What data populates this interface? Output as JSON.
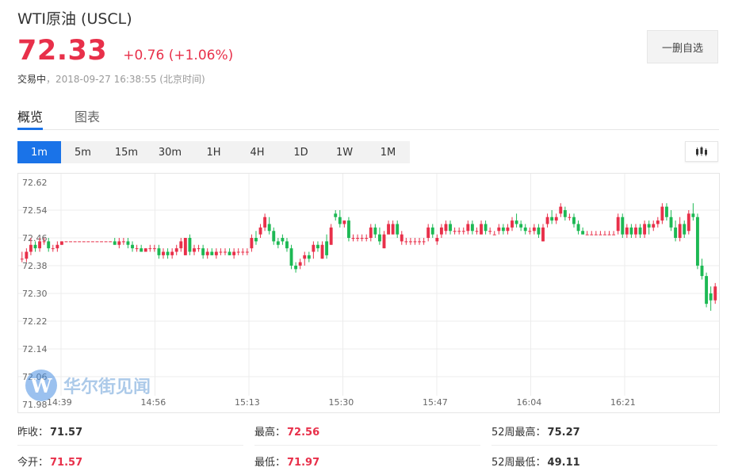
{
  "header": {
    "title": "WTI原油 (USCL)",
    "price": "72.33",
    "change": "+0.76 (+1.06%)",
    "status_label": "交易中",
    "timestamp": "，2018-09-27 16:38:55 (北京时间)",
    "watch_button": "一删自选"
  },
  "tabs": [
    {
      "label": "概览",
      "active": true
    },
    {
      "label": "图表",
      "active": false
    }
  ],
  "periods": [
    {
      "label": "1m",
      "active": true
    },
    {
      "label": "5m"
    },
    {
      "label": "15m"
    },
    {
      "label": "30m"
    },
    {
      "label": "1H"
    },
    {
      "label": "4H"
    },
    {
      "label": "1D"
    },
    {
      "label": "1W"
    },
    {
      "label": "1M"
    }
  ],
  "chart_type_icon": "candlestick-icon",
  "watermark": {
    "logo_letter": "W",
    "text": "华尔街见闻"
  },
  "colors": {
    "up": "#e8304a",
    "down": "#1db954",
    "accent": "#1a73e8"
  },
  "chart_data": {
    "type": "candlestick",
    "y_ticks": [
      "72.62",
      "72.54",
      "72.46",
      "72.38",
      "72.30",
      "72.22",
      "72.14",
      "72.06",
      "71.98"
    ],
    "ylim": [
      71.98,
      72.62
    ],
    "x_ticks": [
      "14:39",
      "14:56",
      "15:13",
      "15:30",
      "15:47",
      "16:04",
      "16:21"
    ],
    "grid": true,
    "candles": [
      [
        72.4,
        72.42,
        72.39,
        72.4
      ],
      [
        72.4,
        72.43,
        72.39,
        72.42
      ],
      [
        72.42,
        72.46,
        72.41,
        72.44
      ],
      [
        72.44,
        72.45,
        72.42,
        72.43
      ],
      [
        72.43,
        72.46,
        72.42,
        72.45
      ],
      [
        72.45,
        72.46,
        72.44,
        72.45
      ],
      [
        72.45,
        72.46,
        72.42,
        72.43
      ],
      [
        72.43,
        72.44,
        72.42,
        72.43
      ],
      [
        72.43,
        72.45,
        72.42,
        72.44
      ],
      [
        72.44,
        72.45,
        72.44,
        72.45
      ],
      [
        72.45,
        72.45,
        72.45,
        72.45
      ],
      [
        72.45,
        72.45,
        72.45,
        72.45
      ],
      [
        72.45,
        72.45,
        72.45,
        72.45
      ],
      [
        72.45,
        72.45,
        72.45,
        72.45
      ],
      [
        72.45,
        72.45,
        72.45,
        72.45
      ],
      [
        72.45,
        72.45,
        72.45,
        72.45
      ],
      [
        72.45,
        72.45,
        72.45,
        72.45
      ],
      [
        72.45,
        72.45,
        72.45,
        72.45
      ],
      [
        72.45,
        72.45,
        72.45,
        72.45
      ],
      [
        72.45,
        72.45,
        72.45,
        72.45
      ],
      [
        72.45,
        72.45,
        72.45,
        72.45
      ],
      [
        72.45,
        72.46,
        72.44,
        72.44
      ],
      [
        72.44,
        72.46,
        72.43,
        72.45
      ],
      [
        72.45,
        72.46,
        72.44,
        72.45
      ],
      [
        72.45,
        72.46,
        72.43,
        72.44
      ],
      [
        72.44,
        72.45,
        72.42,
        72.43
      ],
      [
        72.43,
        72.44,
        72.42,
        72.43
      ],
      [
        72.43,
        72.44,
        72.42,
        72.42
      ],
      [
        72.42,
        72.43,
        72.42,
        72.43
      ],
      [
        72.43,
        72.44,
        72.42,
        72.43
      ],
      [
        72.43,
        72.44,
        72.42,
        72.43
      ],
      [
        72.43,
        72.44,
        72.4,
        72.41
      ],
      [
        72.41,
        72.43,
        72.4,
        72.42
      ],
      [
        72.42,
        72.43,
        72.4,
        72.41
      ],
      [
        72.41,
        72.43,
        72.4,
        72.42
      ],
      [
        72.42,
        72.44,
        72.41,
        72.43
      ],
      [
        72.43,
        72.46,
        72.42,
        72.45
      ],
      [
        72.41,
        72.46,
        72.41,
        72.46
      ],
      [
        72.46,
        72.47,
        72.41,
        72.42
      ],
      [
        72.42,
        72.44,
        72.41,
        72.43
      ],
      [
        72.43,
        72.44,
        72.42,
        72.43
      ],
      [
        72.43,
        72.44,
        72.4,
        72.41
      ],
      [
        72.41,
        72.43,
        72.4,
        72.42
      ],
      [
        72.42,
        72.43,
        72.41,
        72.41
      ],
      [
        72.41,
        72.43,
        72.4,
        72.42
      ],
      [
        72.42,
        72.43,
        72.41,
        72.42
      ],
      [
        72.42,
        72.43,
        72.41,
        72.42
      ],
      [
        72.42,
        72.43,
        72.41,
        72.41
      ],
      [
        72.41,
        72.43,
        72.4,
        72.42
      ],
      [
        72.42,
        72.43,
        72.41,
        72.42
      ],
      [
        72.42,
        72.43,
        72.41,
        72.42
      ],
      [
        72.42,
        72.43,
        72.41,
        72.42
      ],
      [
        72.43,
        72.47,
        72.42,
        72.46
      ],
      [
        72.46,
        72.48,
        72.44,
        72.45
      ],
      [
        72.47,
        72.5,
        72.46,
        72.49
      ],
      [
        72.49,
        72.53,
        72.48,
        72.52
      ],
      [
        72.5,
        72.52,
        72.47,
        72.48
      ],
      [
        72.48,
        72.49,
        72.44,
        72.45
      ],
      [
        72.45,
        72.46,
        72.43,
        72.44
      ],
      [
        72.46,
        72.47,
        72.44,
        72.45
      ],
      [
        72.45,
        72.46,
        72.42,
        72.43
      ],
      [
        72.43,
        72.44,
        72.37,
        72.38
      ],
      [
        72.38,
        72.39,
        72.36,
        72.37
      ],
      [
        72.38,
        72.4,
        72.37,
        72.39
      ],
      [
        72.4,
        72.42,
        72.38,
        72.41
      ],
      [
        72.41,
        72.42,
        72.39,
        72.4
      ],
      [
        72.42,
        72.45,
        72.4,
        72.44
      ],
      [
        72.44,
        72.45,
        72.42,
        72.43
      ],
      [
        72.4,
        72.45,
        72.4,
        72.44
      ],
      [
        72.45,
        72.47,
        72.4,
        72.41
      ],
      [
        72.44,
        72.5,
        72.44,
        72.49
      ],
      [
        72.53,
        72.54,
        72.51,
        72.52
      ],
      [
        72.52,
        72.54,
        72.49,
        72.5
      ],
      [
        72.5,
        72.51,
        72.49,
        72.51
      ],
      [
        72.51,
        72.52,
        72.45,
        72.46
      ],
      [
        72.46,
        72.47,
        72.45,
        72.46
      ],
      [
        72.46,
        72.47,
        72.45,
        72.46
      ],
      [
        72.46,
        72.47,
        72.45,
        72.46
      ],
      [
        72.46,
        72.47,
        72.45,
        72.46
      ],
      [
        72.46,
        72.5,
        72.45,
        72.49
      ],
      [
        72.49,
        72.5,
        72.46,
        72.47
      ],
      [
        72.47,
        72.49,
        72.44,
        72.45
      ],
      [
        72.43,
        72.48,
        72.43,
        72.47
      ],
      [
        72.47,
        72.51,
        72.47,
        72.5
      ],
      [
        72.47,
        72.51,
        72.47,
        72.5
      ],
      [
        72.5,
        72.51,
        72.46,
        72.47
      ],
      [
        72.45,
        72.48,
        72.44,
        72.47
      ],
      [
        72.45,
        72.46,
        72.44,
        72.45
      ],
      [
        72.45,
        72.46,
        72.44,
        72.45
      ],
      [
        72.45,
        72.46,
        72.44,
        72.45
      ],
      [
        72.45,
        72.46,
        72.44,
        72.45
      ],
      [
        72.45,
        72.46,
        72.44,
        72.45
      ],
      [
        72.46,
        72.5,
        72.45,
        72.49
      ],
      [
        72.49,
        72.5,
        72.46,
        72.47
      ],
      [
        72.45,
        72.47,
        72.44,
        72.46
      ],
      [
        72.47,
        72.5,
        72.46,
        72.49
      ],
      [
        72.48,
        72.51,
        72.47,
        72.5
      ],
      [
        72.5,
        72.51,
        72.47,
        72.48
      ],
      [
        72.48,
        72.49,
        72.47,
        72.48
      ],
      [
        72.48,
        72.49,
        72.47,
        72.48
      ],
      [
        72.48,
        72.49,
        72.47,
        72.48
      ],
      [
        72.48,
        72.51,
        72.47,
        72.5
      ],
      [
        72.5,
        72.51,
        72.47,
        72.48
      ],
      [
        72.48,
        72.49,
        72.47,
        72.48
      ],
      [
        72.47,
        72.51,
        72.47,
        72.5
      ],
      [
        72.5,
        72.51,
        72.47,
        72.48
      ],
      [
        72.48,
        72.49,
        72.47,
        72.48
      ],
      [
        72.47,
        72.48,
        72.47,
        72.47
      ],
      [
        72.48,
        72.5,
        72.47,
        72.49
      ],
      [
        72.49,
        72.5,
        72.47,
        72.48
      ],
      [
        72.48,
        72.5,
        72.47,
        72.49
      ],
      [
        72.49,
        72.52,
        72.48,
        72.51
      ],
      [
        72.51,
        72.53,
        72.49,
        72.5
      ],
      [
        72.5,
        72.51,
        72.48,
        72.49
      ],
      [
        72.49,
        72.5,
        72.47,
        72.48
      ],
      [
        72.48,
        72.49,
        72.47,
        72.48
      ],
      [
        72.48,
        72.5,
        72.47,
        72.49
      ],
      [
        72.49,
        72.5,
        72.46,
        72.47
      ],
      [
        72.45,
        72.5,
        72.45,
        72.49
      ],
      [
        72.5,
        72.53,
        72.49,
        72.52
      ],
      [
        72.52,
        72.54,
        72.5,
        72.51
      ],
      [
        72.51,
        72.53,
        72.5,
        72.52
      ],
      [
        72.53,
        72.56,
        72.52,
        72.55
      ],
      [
        72.54,
        72.55,
        72.51,
        72.52
      ],
      [
        72.52,
        72.53,
        72.51,
        72.52
      ],
      [
        72.52,
        72.53,
        72.49,
        72.5
      ],
      [
        72.5,
        72.51,
        72.47,
        72.48
      ],
      [
        72.48,
        72.49,
        72.47,
        72.47
      ],
      [
        72.47,
        72.48,
        72.47,
        72.47
      ],
      [
        72.47,
        72.48,
        72.47,
        72.47
      ],
      [
        72.47,
        72.48,
        72.47,
        72.47
      ],
      [
        72.47,
        72.48,
        72.47,
        72.47
      ],
      [
        72.47,
        72.48,
        72.47,
        72.47
      ],
      [
        72.47,
        72.48,
        72.47,
        72.47
      ],
      [
        72.47,
        72.48,
        72.47,
        72.47
      ],
      [
        72.48,
        72.53,
        72.47,
        72.52
      ],
      [
        72.52,
        72.53,
        72.46,
        72.47
      ],
      [
        72.47,
        72.5,
        72.46,
        72.49
      ],
      [
        72.49,
        72.5,
        72.46,
        72.47
      ],
      [
        72.47,
        72.5,
        72.46,
        72.49
      ],
      [
        72.49,
        72.5,
        72.46,
        72.47
      ],
      [
        72.47,
        72.51,
        72.46,
        72.5
      ],
      [
        72.5,
        72.51,
        72.47,
        72.49
      ],
      [
        72.49,
        72.51,
        72.48,
        72.5
      ],
      [
        72.5,
        72.52,
        72.49,
        72.51
      ],
      [
        72.51,
        72.56,
        72.5,
        72.55
      ],
      [
        72.55,
        72.56,
        72.51,
        72.52
      ],
      [
        72.52,
        72.54,
        72.48,
        72.49
      ],
      [
        72.49,
        72.51,
        72.45,
        72.46
      ],
      [
        72.46,
        72.52,
        72.45,
        72.5
      ],
      [
        72.5,
        72.51,
        72.46,
        72.47
      ],
      [
        72.48,
        72.54,
        72.47,
        72.53
      ],
      [
        72.53,
        72.56,
        72.51,
        72.52
      ],
      [
        72.52,
        72.53,
        72.37,
        72.38
      ],
      [
        72.38,
        72.4,
        72.34,
        72.35
      ],
      [
        72.35,
        72.36,
        72.26,
        72.27
      ],
      [
        72.3,
        72.32,
        72.25,
        72.28
      ],
      [
        72.28,
        72.33,
        72.27,
        72.32
      ]
    ]
  },
  "stats": [
    {
      "label": "昨收：",
      "value": "71.57",
      "red": false
    },
    {
      "label": "最高：",
      "value": "72.56",
      "red": true
    },
    {
      "label": "52周最高：",
      "value": "75.27",
      "red": false
    },
    {
      "label": "今开：",
      "value": "71.57",
      "red": true
    },
    {
      "label": "最低：",
      "value": "71.97",
      "red": true
    },
    {
      "label": "52周最低：",
      "value": "49.11",
      "red": false
    }
  ]
}
